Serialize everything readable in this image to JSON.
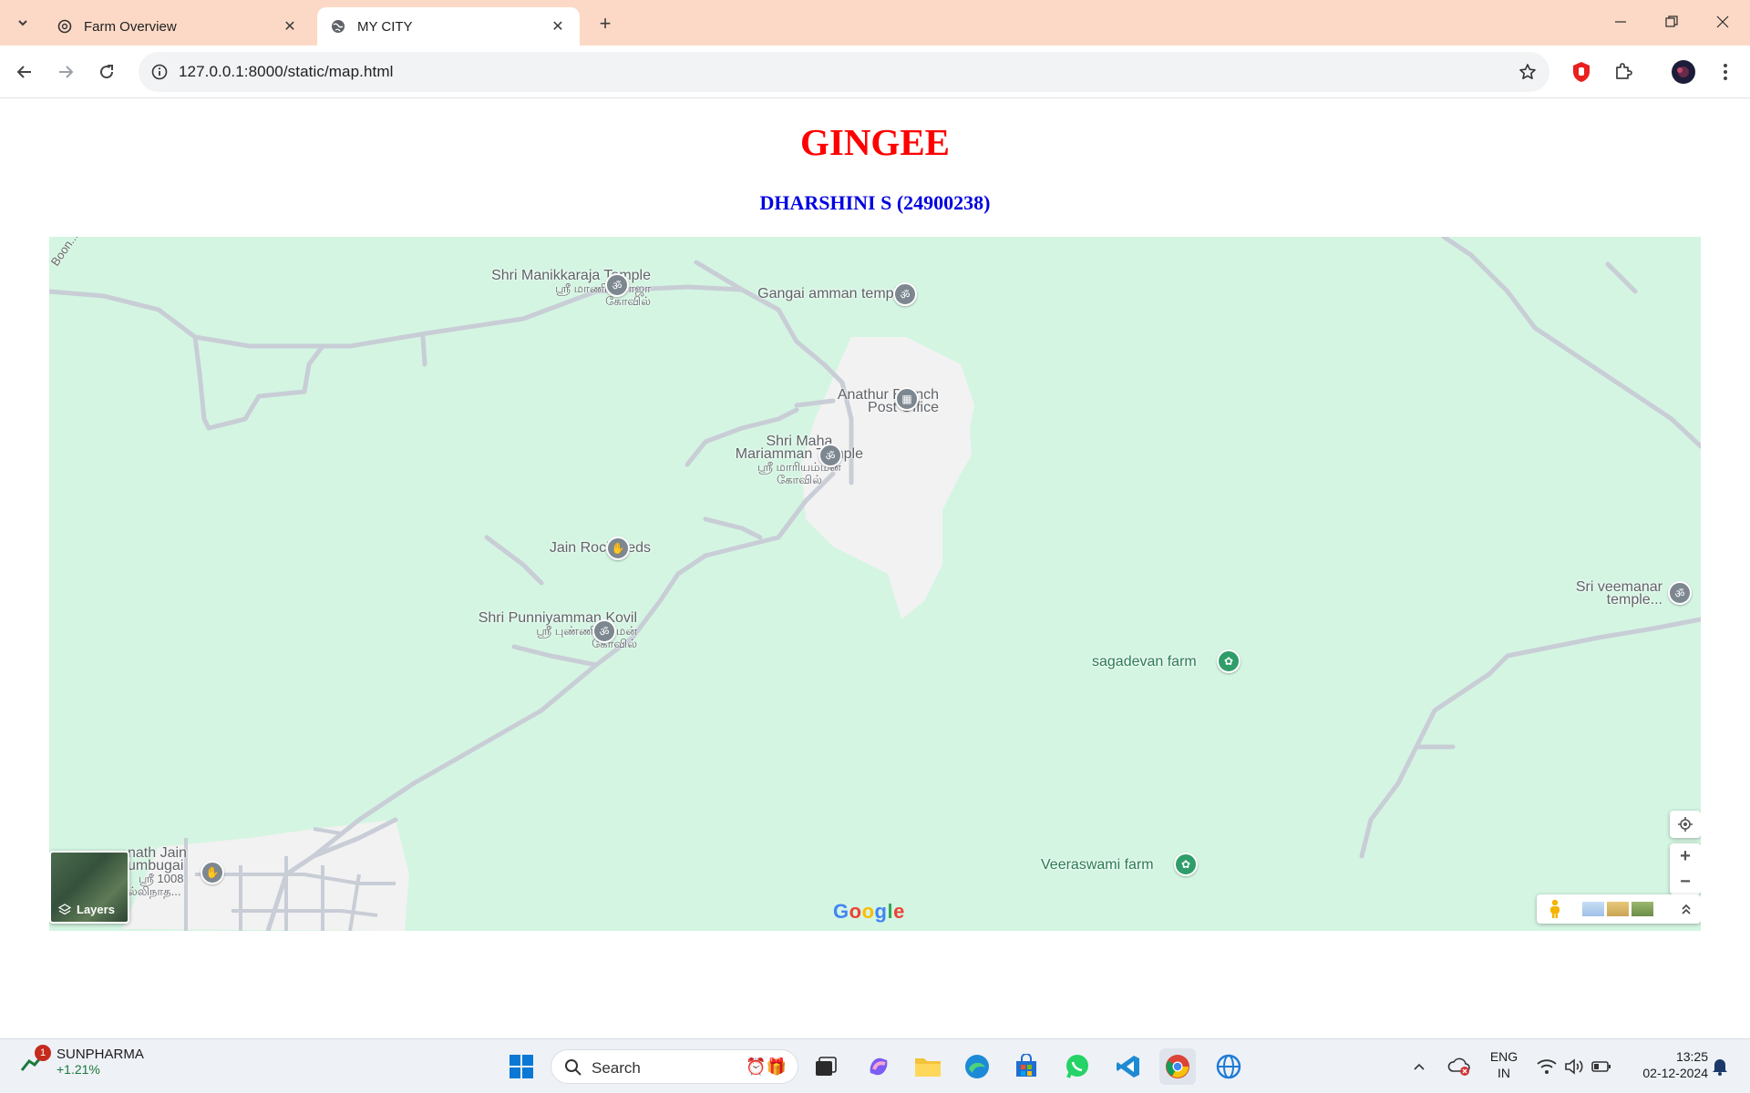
{
  "browser": {
    "tabs": [
      {
        "title": "Farm Overview",
        "active": false
      },
      {
        "title": "MY CITY",
        "active": true
      }
    ],
    "url": "127.0.0.1:8000/static/map.html"
  },
  "page": {
    "title": "GINGEE",
    "subtitle": "DHARSHINI S (24900238)"
  },
  "map": {
    "road_label": "Boon...",
    "pois": [
      {
        "name": "Shri Manikkaraja Temple",
        "sub": "ஸ்ரீ மாணிக்கராஜா",
        "sub2": "கோவில்"
      },
      {
        "name": "Gangai amman temple"
      },
      {
        "name": "Anathur Branch",
        "name2": "Post Office"
      },
      {
        "name": "Shri Maha",
        "name2": "Mariamman Temple",
        "sub": "ஸ்ரீ மாரியம்மன்",
        "sub2": "கோவில்"
      },
      {
        "name": "Jain Rock Beds"
      },
      {
        "name": "Shri Punniyamman Kovil",
        "sub": "ஸ்ரீ புண்ணியம்மன்",
        "sub2": "கோவில்"
      },
      {
        "name": "Sri veemanar",
        "name2": "temple..."
      },
      {
        "name": "nath Jain",
        "name2": "umbugai",
        "sub": "ஸ்ரீ 1008",
        "sub2": "ல்லிநாத..."
      }
    ],
    "farms": [
      {
        "name": "sagadevan farm"
      },
      {
        "name": "Veeraswami farm"
      }
    ],
    "layers_label": "Layers",
    "logo": "Google"
  },
  "taskbar": {
    "stock_name": "SUNPHARMA",
    "stock_change": "+1.21%",
    "stock_badge": "1",
    "search_label": "Search",
    "lang_top": "ENG",
    "lang_bottom": "IN",
    "time": "13:25",
    "date": "02-12-2024"
  }
}
